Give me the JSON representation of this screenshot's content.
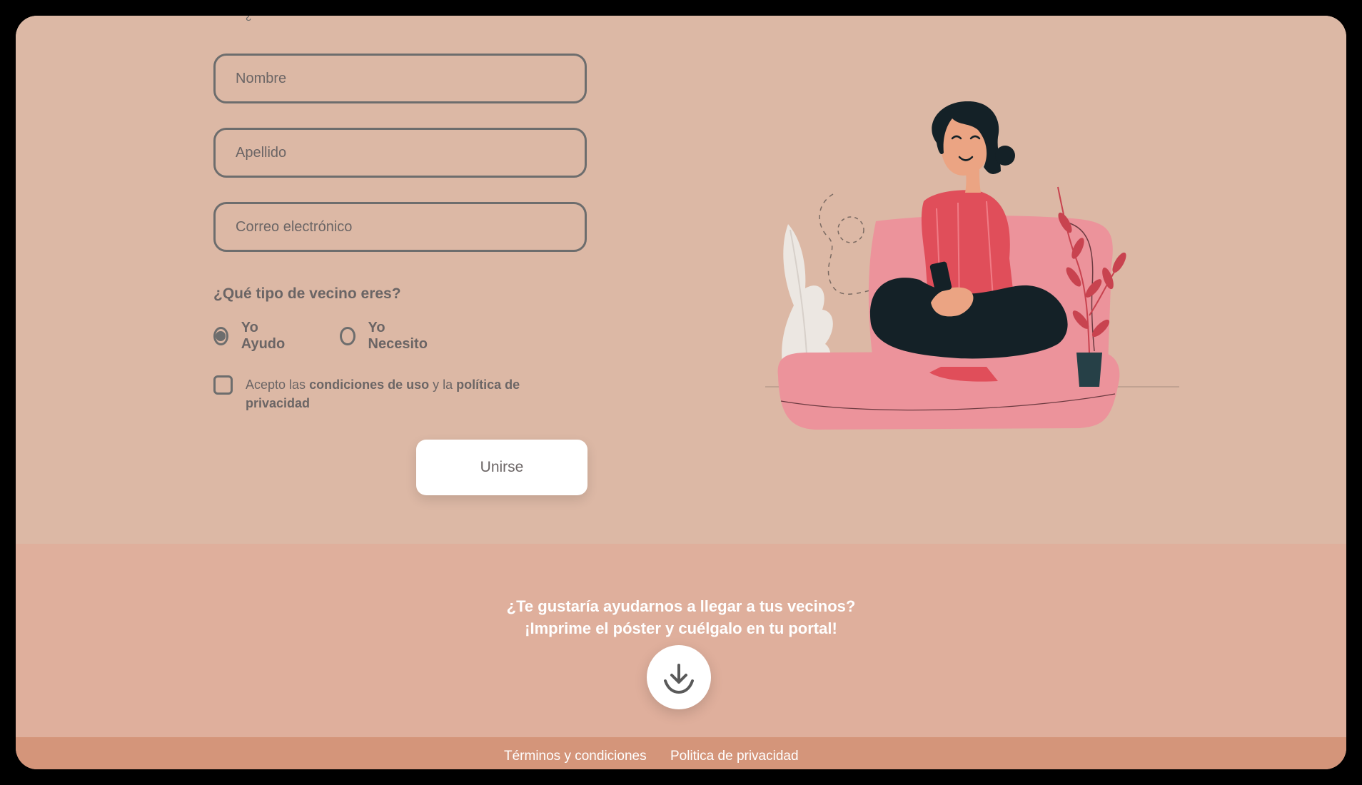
{
  "form": {
    "cropped_top_glyph": "¿",
    "fields": {
      "nombre_placeholder": "Nombre",
      "apellido_placeholder": "Apellido",
      "correo_placeholder": "Correo electrónico"
    },
    "question": "¿Qué tipo de vecino eres?",
    "radios": {
      "ayudo_label": "Yo Ayudo",
      "necesito_label": "Yo Necesito",
      "selected": "Yo Ayudo"
    },
    "consent": {
      "prefix": "Acepto las",
      "terms_link": "condiciones de uso",
      "middle": " y la",
      "privacy_link": "política de privacidad",
      "checked": false
    },
    "submit_label": "Unirse"
  },
  "cta": {
    "line1": "¿Te gustaría ayudarnos a llegar a tus vecinos?",
    "line2": "¡Imprime el póster y cuélgalo en tu portal!",
    "download_icon": "download-icon"
  },
  "footer": {
    "terms_label": "Términos y condiciones",
    "privacy_label": "Politica de privacidad"
  },
  "colors": {
    "form_background": "#dcb8a5",
    "cta_background": "#dfaf9c",
    "footer_background": "#d4957a",
    "text": "#6b6565",
    "accent": "#e04e5a"
  }
}
